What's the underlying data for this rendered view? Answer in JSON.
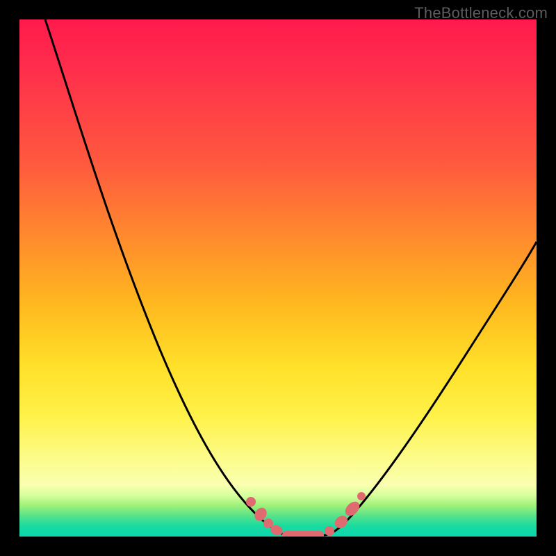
{
  "watermark": "TheBottleneck.com",
  "chart_data": {
    "type": "line",
    "title": "",
    "xlabel": "",
    "ylabel": "",
    "xlim": [
      0,
      100
    ],
    "ylim": [
      0,
      100
    ],
    "grid": false,
    "series": [
      {
        "name": "left-curve",
        "x": [
          5,
          10,
          15,
          20,
          25,
          30,
          35,
          40,
          44,
          48,
          50
        ],
        "y": [
          100,
          82,
          66,
          52,
          40,
          29,
          20,
          12,
          6,
          2,
          0
        ]
      },
      {
        "name": "right-curve",
        "x": [
          58,
          60,
          62,
          66,
          70,
          75,
          80,
          85,
          90,
          95,
          100
        ],
        "y": [
          0,
          2,
          5,
          10,
          16,
          23,
          30,
          37,
          44,
          51,
          58
        ]
      },
      {
        "name": "plateau",
        "x": [
          50,
          51,
          52,
          53,
          54,
          55,
          56,
          57,
          58
        ],
        "y": [
          0,
          0,
          0,
          0,
          0,
          0,
          0,
          0,
          0
        ]
      },
      {
        "name": "markers",
        "color": "#e06a6f",
        "x": [
          44,
          46,
          48,
          50,
          52,
          54,
          56,
          58,
          60,
          62
        ],
        "y": [
          6,
          3.5,
          2,
          0.6,
          0,
          0,
          0,
          0.5,
          2,
          5
        ]
      }
    ],
    "colors": {
      "curve": "#000000",
      "marker": "#e06a6f",
      "gradient": [
        "#ff1a4d",
        "#ff8a2d",
        "#ffe029",
        "#faffb0",
        "#18dba0"
      ]
    }
  }
}
